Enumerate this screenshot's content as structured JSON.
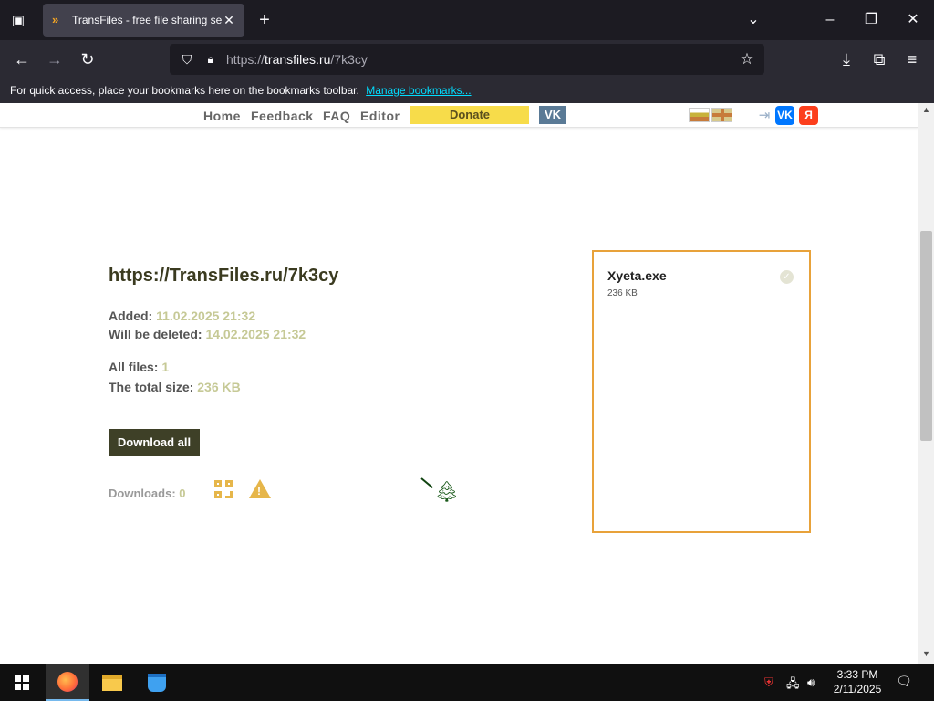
{
  "browser": {
    "tab_title": "TransFiles - free file sharing serv",
    "url_domain": "transfiles.ru",
    "url_prefix": "https://",
    "url_path": "/7k3cy",
    "bookmarks_message": "For quick access, place your bookmarks here on the bookmarks toolbar.",
    "bookmarks_link": "Manage bookmarks..."
  },
  "nav": {
    "links": [
      "Home",
      "Feedback",
      "FAQ",
      "Editor"
    ],
    "donate": "Donate",
    "vk": "VK",
    "vk_square": "VK",
    "ya_square": "Я"
  },
  "share": {
    "url": "https://TransFiles.ru/7k3cy",
    "added_label": "Added:",
    "added_value": "11.02.2025 21:32",
    "deleted_label": "Will be deleted:",
    "deleted_value": "14.02.2025 21:32",
    "files_label": "All files:",
    "files_value": "1",
    "size_label": "The total size:",
    "size_value": "236 KB",
    "download_all": "Download all",
    "downloads_label": "Downloads:",
    "downloads_value": "0"
  },
  "file": {
    "name": "Xyeta.exe",
    "size": "236 KB"
  },
  "taskbar": {
    "time": "3:33 PM",
    "date": "2/11/2025"
  },
  "colors": {
    "accent_orange": "#e8a23a",
    "donate_yellow": "#f7dc4a",
    "button_dark": "#3e4027",
    "value_olive": "#c6c996"
  }
}
